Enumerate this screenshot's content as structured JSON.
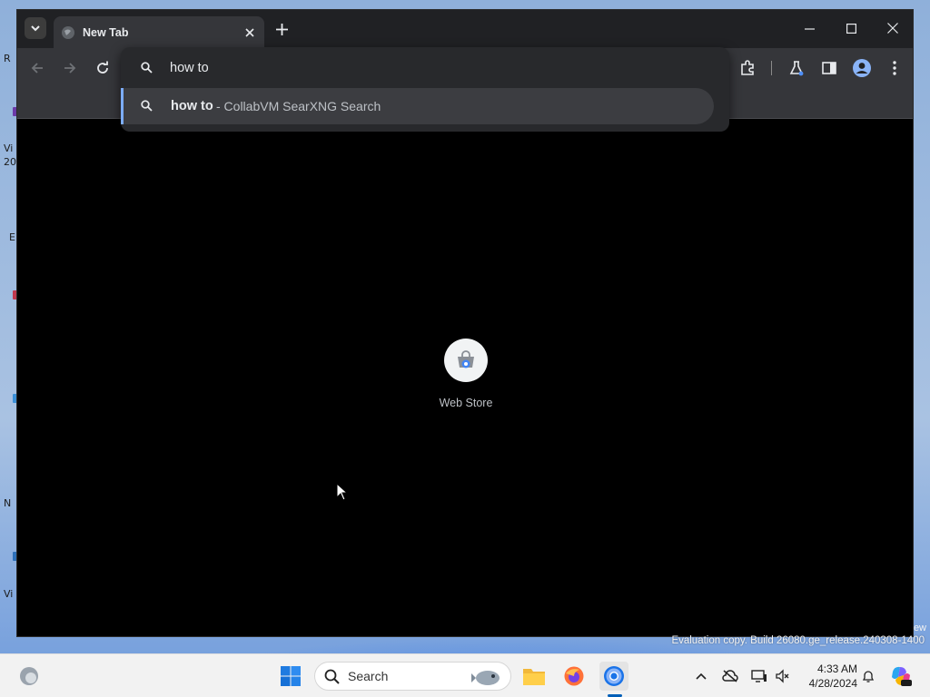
{
  "desktop": {
    "left_fragments": [
      "R",
      "Vi",
      "20",
      "E",
      "N",
      "Vi"
    ]
  },
  "browser": {
    "tab": {
      "title": "New Tab"
    },
    "omnibox": {
      "value": "how to",
      "suggestion": {
        "query": "how to",
        "engine": "- CollabVM SearXNG Search"
      }
    },
    "shortcut": {
      "label": "Web Store"
    }
  },
  "watermark": {
    "edge": "ew",
    "text": "Evaluation copy. Build 26080.ge_release.240308-1400"
  },
  "taskbar": {
    "search_label": "Search",
    "clock": {
      "time": "4:33 AM",
      "date": "4/28/2024"
    }
  },
  "colors": {
    "accent": "#7cacf8",
    "toolbar": "#35363a",
    "titlebar": "#202124",
    "taskbar": "#f2f2f2"
  }
}
